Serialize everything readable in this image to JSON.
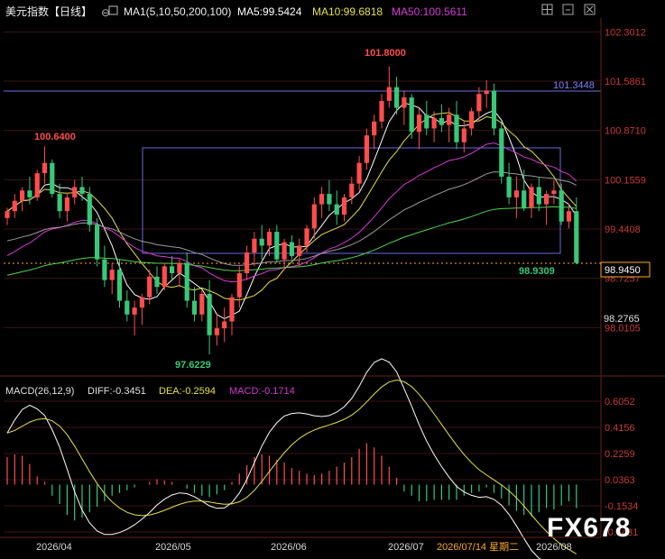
{
  "header": {
    "title": "美元指数【日线】",
    "ma_label": "MA1(5,10,50,200,100)",
    "ma5_label": "MA5:99.5424",
    "ma10_label": "MA10:99.6818",
    "ma50_label": "MA50:100.5611"
  },
  "macd_header": {
    "label": "MACD(26,12,9)",
    "diff": "DIFF:-0.3451",
    "dea": "DEA:-0.2594",
    "macd": "MACD:-0.1714"
  },
  "colors": {
    "up": "#ff4d4d",
    "down": "#38c878",
    "ma5": "#ffffff",
    "ma10": "#e6e04a",
    "ma50": "#d63ad6",
    "ma100": "#9a9a9a",
    "ma200": "#4fd44f",
    "grid": "#3a1414",
    "axis_text": "#c83a3a",
    "box": "#6a6adc"
  },
  "chart_data": {
    "type": "candlestick",
    "y_ticks": [
      "102.3012",
      "101.5861",
      "100.8710",
      "100.1559",
      "99.4408",
      "98.7257",
      "98.0105"
    ],
    "ylim": [
      97.4,
      102.45
    ],
    "current_price": "98.9450",
    "reference_price": "98.2765",
    "resistance_label": "101.3448",
    "annotations": {
      "high_1": "100.6400",
      "low": "97.6229",
      "high_2": "101.8000",
      "last_low": "98.9309"
    },
    "x_labels": [
      "2026/04",
      "2026/05",
      "2026/06",
      "2026/07",
      "2026/07/14 星期二",
      "2026/08"
    ],
    "macd_ticks": [
      "0.6052",
      "0.4156",
      "0.2259",
      "0.0363",
      "-0.1534",
      "-0.3431"
    ],
    "candles": [
      [
        99.6,
        99.75,
        99.5,
        99.7
      ],
      [
        99.7,
        99.95,
        99.6,
        99.85
      ],
      [
        99.85,
        100.05,
        99.7,
        100.0
      ],
      [
        100.0,
        100.2,
        99.8,
        99.9
      ],
      [
        99.9,
        100.3,
        99.85,
        100.25
      ],
      [
        100.25,
        100.64,
        100.1,
        100.4
      ],
      [
        100.4,
        100.45,
        99.9,
        99.95
      ],
      [
        99.95,
        100.1,
        99.6,
        99.7
      ],
      [
        99.7,
        99.95,
        99.55,
        99.9
      ],
      [
        99.9,
        100.15,
        99.8,
        100.05
      ],
      [
        100.05,
        100.2,
        99.85,
        99.95
      ],
      [
        99.95,
        100.05,
        99.4,
        99.5
      ],
      [
        99.5,
        99.6,
        98.9,
        99.0
      ],
      [
        99.0,
        99.2,
        98.6,
        98.7
      ],
      [
        98.7,
        98.95,
        98.5,
        98.85
      ],
      [
        98.85,
        99.0,
        98.3,
        98.4
      ],
      [
        98.4,
        98.55,
        98.1,
        98.2
      ],
      [
        98.2,
        98.4,
        97.9,
        98.3
      ],
      [
        98.3,
        98.5,
        98.05,
        98.45
      ],
      [
        98.45,
        98.85,
        98.35,
        98.75
      ],
      [
        98.75,
        98.9,
        98.5,
        98.6
      ],
      [
        98.6,
        98.95,
        98.55,
        98.9
      ],
      [
        98.9,
        99.05,
        98.7,
        98.8
      ],
      [
        98.8,
        99.0,
        98.6,
        98.95
      ],
      [
        98.95,
        99.1,
        98.3,
        98.4
      ],
      [
        98.4,
        98.6,
        98.1,
        98.2
      ],
      [
        98.2,
        98.55,
        98.1,
        98.5
      ],
      [
        98.5,
        98.7,
        97.62,
        97.9
      ],
      [
        97.9,
        98.2,
        97.75,
        98.0
      ],
      [
        98.0,
        98.3,
        97.8,
        98.1
      ],
      [
        98.1,
        98.5,
        97.9,
        98.45
      ],
      [
        98.45,
        98.9,
        98.3,
        98.8
      ],
      [
        98.8,
        99.2,
        98.7,
        99.1
      ],
      [
        99.1,
        99.4,
        98.9,
        99.3
      ],
      [
        99.3,
        99.5,
        99.0,
        99.2
      ],
      [
        99.2,
        99.45,
        99.05,
        99.4
      ],
      [
        99.4,
        99.5,
        98.95,
        99.0
      ],
      [
        99.0,
        99.3,
        98.85,
        99.25
      ],
      [
        99.25,
        99.35,
        99.0,
        99.05
      ],
      [
        99.05,
        99.3,
        98.9,
        99.2
      ],
      [
        99.2,
        99.5,
        99.1,
        99.45
      ],
      [
        99.45,
        99.9,
        99.3,
        99.8
      ],
      [
        99.8,
        100.05,
        99.6,
        99.95
      ],
      [
        99.95,
        100.15,
        99.7,
        99.8
      ],
      [
        99.8,
        100.0,
        99.5,
        99.65
      ],
      [
        99.65,
        99.95,
        99.55,
        99.9
      ],
      [
        99.9,
        100.2,
        99.8,
        100.1
      ],
      [
        100.1,
        100.5,
        100.0,
        100.4
      ],
      [
        100.4,
        100.9,
        100.3,
        100.8
      ],
      [
        100.8,
        101.1,
        100.6,
        101.0
      ],
      [
        101.0,
        101.4,
        100.9,
        101.3
      ],
      [
        101.3,
        101.8,
        101.2,
        101.5
      ],
      [
        101.5,
        101.65,
        101.1,
        101.2
      ],
      [
        101.2,
        101.45,
        100.95,
        101.35
      ],
      [
        101.35,
        101.4,
        100.75,
        100.85
      ],
      [
        100.85,
        101.2,
        100.6,
        101.1
      ],
      [
        101.1,
        101.3,
        100.8,
        100.9
      ],
      [
        100.9,
        101.15,
        100.7,
        101.05
      ],
      [
        101.05,
        101.25,
        100.85,
        100.95
      ],
      [
        100.95,
        101.2,
        100.7,
        101.1
      ],
      [
        101.1,
        101.3,
        100.6,
        100.7
      ],
      [
        100.7,
        101.0,
        100.55,
        100.9
      ],
      [
        100.9,
        101.2,
        100.8,
        101.15
      ],
      [
        101.15,
        101.5,
        101.0,
        101.4
      ],
      [
        101.4,
        101.6,
        101.2,
        101.45
      ],
      [
        101.45,
        101.55,
        100.8,
        100.9
      ],
      [
        100.9,
        101.0,
        100.1,
        100.2
      ],
      [
        100.2,
        100.4,
        99.8,
        99.9
      ],
      [
        99.9,
        100.2,
        99.6,
        100.0
      ],
      [
        100.0,
        100.3,
        99.7,
        99.75
      ],
      [
        99.75,
        100.1,
        99.6,
        100.05
      ],
      [
        100.05,
        100.2,
        99.7,
        99.8
      ],
      [
        99.8,
        100.0,
        99.5,
        99.95
      ],
      [
        99.95,
        100.15,
        99.8,
        100.0
      ],
      [
        100.0,
        100.1,
        99.5,
        99.55
      ],
      [
        99.55,
        99.8,
        99.45,
        99.7
      ],
      [
        99.7,
        99.9,
        98.93,
        98.95
      ]
    ],
    "macd_values": [
      0.2,
      0.22,
      0.21,
      0.15,
      0.06,
      0.02,
      -0.08,
      -0.14,
      -0.22,
      -0.26,
      -0.24,
      -0.2,
      -0.16,
      -0.12,
      -0.08,
      -0.06,
      -0.04,
      -0.02,
      0.0,
      0.02,
      0.04,
      0.03,
      0.02,
      0.0,
      -0.03,
      -0.06,
      -0.08,
      -0.09,
      -0.07,
      -0.04,
      0.02,
      0.08,
      0.14,
      0.2,
      0.22,
      0.21,
      0.18,
      0.16,
      0.12,
      0.1,
      0.08,
      0.07,
      0.08,
      0.1,
      0.13,
      0.16,
      0.2,
      0.26,
      0.3,
      0.27,
      0.21,
      0.13,
      0.05,
      -0.05,
      -0.08,
      -0.12,
      -0.12,
      -0.11,
      -0.11,
      -0.11,
      -0.11,
      -0.08,
      -0.06,
      -0.05,
      -0.02,
      -0.06,
      -0.1,
      -0.15,
      -0.19,
      -0.22,
      -0.23,
      -0.2,
      -0.17,
      -0.18,
      -0.15,
      -0.12,
      -0.17
    ]
  },
  "watermark": "FX678"
}
